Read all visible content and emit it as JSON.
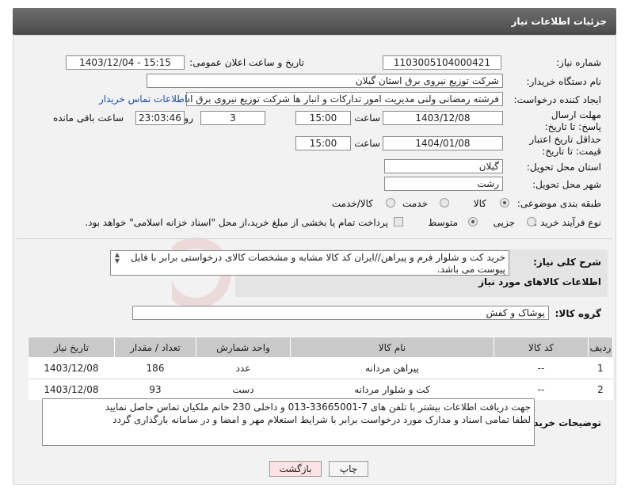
{
  "header": {
    "title": "جزئیات اطلاعات نیاز"
  },
  "form": {
    "need_number": {
      "label": "شماره نیاز:",
      "value": "1103005104000421"
    },
    "announce": {
      "label": "تاریخ و ساعت اعلان عمومی:",
      "value": "1403/12/04 - 15:15"
    },
    "buyer_org": {
      "label": "نام دستگاه خریدار:",
      "value": "شرکت توزیع نیروی برق استان گیلان"
    },
    "creator": {
      "label": "ایجاد کننده درخواست:",
      "value": "فرشته رمضانی ولنی مدیریت امور تدارکات و انبار ها شرکت توزیع نیروی برق استا",
      "contact_link": "اطلاعات تماس خریدار"
    },
    "deadline": {
      "label": "مهلت ارسال پاسخ: تا تاریخ:",
      "date": "1403/12/08",
      "time_label": "ساعت",
      "time": "15:00",
      "days": "3",
      "days_label": "روز و",
      "remaining": "23:03:46",
      "remaining_label": "ساعت باقی مانده"
    },
    "validity": {
      "label": "حداقل تاریخ اعتبار قیمت: تا تاریخ:",
      "date": "1404/01/08",
      "time_label": "ساعت",
      "time": "15:00"
    },
    "province": {
      "label": "استان محل تحویل:",
      "value": "گیلان"
    },
    "city": {
      "label": "شهر محل تحویل:",
      "value": "رشت"
    },
    "category": {
      "label": "طبقه بندی موضوعی:",
      "options": [
        "کالا",
        "خدمت",
        "کالا/خدمت"
      ]
    },
    "process": {
      "label": "نوع فرآیند خرید :",
      "options": [
        "جزیی",
        "متوسط"
      ],
      "payment_note": "پرداخت تمام یا بخشی از مبلغ خرید،از محل \"اسناد خزانه اسلامی\" خواهد بود."
    },
    "description": {
      "label": "شرح کلی نیاز:",
      "value": "خرید کت و شلوار فرم و پیراهن//ایران کد کالا مشابه و مشخصات کالای درخواستی برابر با فایل پیوست می باشد."
    }
  },
  "items_section": {
    "title": "اطلاعات کالاهای مورد نیاز",
    "group_label": "گروه کالا:",
    "group_value": "پوشاک و کفش",
    "columns": [
      "ردیف",
      "کد کالا",
      "نام کالا",
      "واحد شمارش",
      "تعداد / مقدار",
      "تاریخ نیاز"
    ],
    "rows": [
      [
        "1",
        "--",
        "پیراهن مردانه",
        "عدد",
        "186",
        "1403/12/08"
      ],
      [
        "2",
        "--",
        "کت و شلوار مردانه",
        "دست",
        "93",
        "1403/12/08"
      ]
    ]
  },
  "buyer_notes": {
    "label": "توضیحات خریدار:",
    "line1": "جهت دریافت اطلاعات بیشتر با تلفن های 7-33665001-013 و داخلی 230 خانم ملکیان تماس حاصل نمایید",
    "line2": "لطفا تمامی اسناد و مدارک مورد درخواست برابر با شرایط استعلام مهر و امضا و در سامانه بارگذاری گردد"
  },
  "buttons": {
    "print": "چاپ",
    "back": "بازگشت"
  },
  "colors": {
    "header_bg": "#5a5a5a",
    "panel_bg": "#f2f2f2",
    "link": "#1a4fa0",
    "back_bg": "#fde3e3"
  }
}
